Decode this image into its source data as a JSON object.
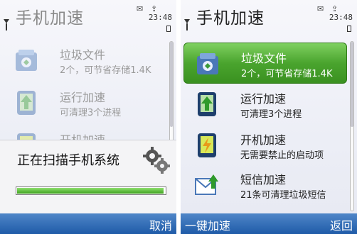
{
  "left_screen": {
    "title": "手机加速",
    "status": {
      "clock": "23:48"
    },
    "items": [
      {
        "name": "垃圾文件",
        "desc": "2个，可节省存储1.4K",
        "icon": "trash-file-icon"
      },
      {
        "name": "运行加速",
        "desc": "可清理3个进程",
        "icon": "up-arrow-phone-icon"
      },
      {
        "name": "开机加速",
        "desc": "",
        "icon": "power-phone-icon"
      }
    ],
    "dialog": {
      "text": "正在扫描手机系统",
      "icon": "gears-icon",
      "progress": 0.98
    },
    "softkeys": {
      "right": "取消"
    }
  },
  "right_screen": {
    "title": "手机加速",
    "status": {
      "clock": "23:48"
    },
    "items": [
      {
        "name": "垃圾文件",
        "desc": "2个，可节省存储1.4K",
        "icon": "trash-file-icon",
        "selected": true
      },
      {
        "name": "运行加速",
        "desc": "可清理3个进程",
        "icon": "up-arrow-phone-icon"
      },
      {
        "name": "开机加速",
        "desc": "无需要禁止的启动项",
        "icon": "power-phone-icon"
      },
      {
        "name": "短信加速",
        "desc": "21条可清理垃圾短信",
        "icon": "envelope-arrow-icon"
      }
    ],
    "softkeys": {
      "left": "一键加速",
      "right": "返回"
    }
  },
  "colors": {
    "selection": "#4aa42e",
    "softkey_bar": "#1f5ba8",
    "progress": "#3fa21e"
  }
}
